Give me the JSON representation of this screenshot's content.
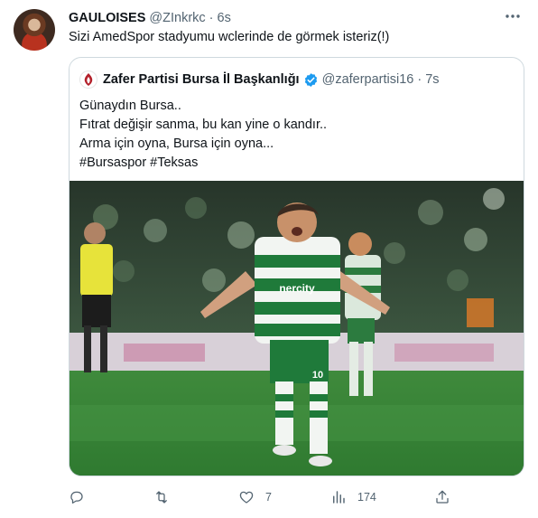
{
  "tweet": {
    "display_name": "GAULOISES",
    "handle": "@ZInkrkc",
    "separator": "·",
    "time": "6s",
    "text": "Sizi AmedSpor stadyumu wclerinde de görmek isteriz(!)"
  },
  "quote": {
    "display_name": "Zafer Partisi Bursa İl Başkanlığı",
    "handle": "@zaferpartisi16",
    "separator": "·",
    "time": "7s",
    "lines": [
      "Günaydın Bursa..",
      "Fıtrat değişir sanma, bu kan yine o kandır..",
      "Arma için oyna, Bursa için oyna...",
      "#Bursaspor #Teksas"
    ],
    "photo": {
      "shirt_text": "nercity",
      "number": "10"
    }
  },
  "actions": {
    "reply": {
      "icon": "reply-icon",
      "count": ""
    },
    "retweet": {
      "icon": "retweet-icon",
      "count": ""
    },
    "like": {
      "icon": "heart-icon",
      "count": "7"
    },
    "views": {
      "icon": "analytics-icon",
      "count": "174"
    },
    "share": {
      "icon": "share-icon",
      "count": ""
    }
  },
  "colors": {
    "text": "#0f1419",
    "secondary": "#536471",
    "verified": "#1d9bf0",
    "border": "#cfd9de",
    "party_red": "#b3202a",
    "bursaspor_green": "#1f7a3a"
  }
}
